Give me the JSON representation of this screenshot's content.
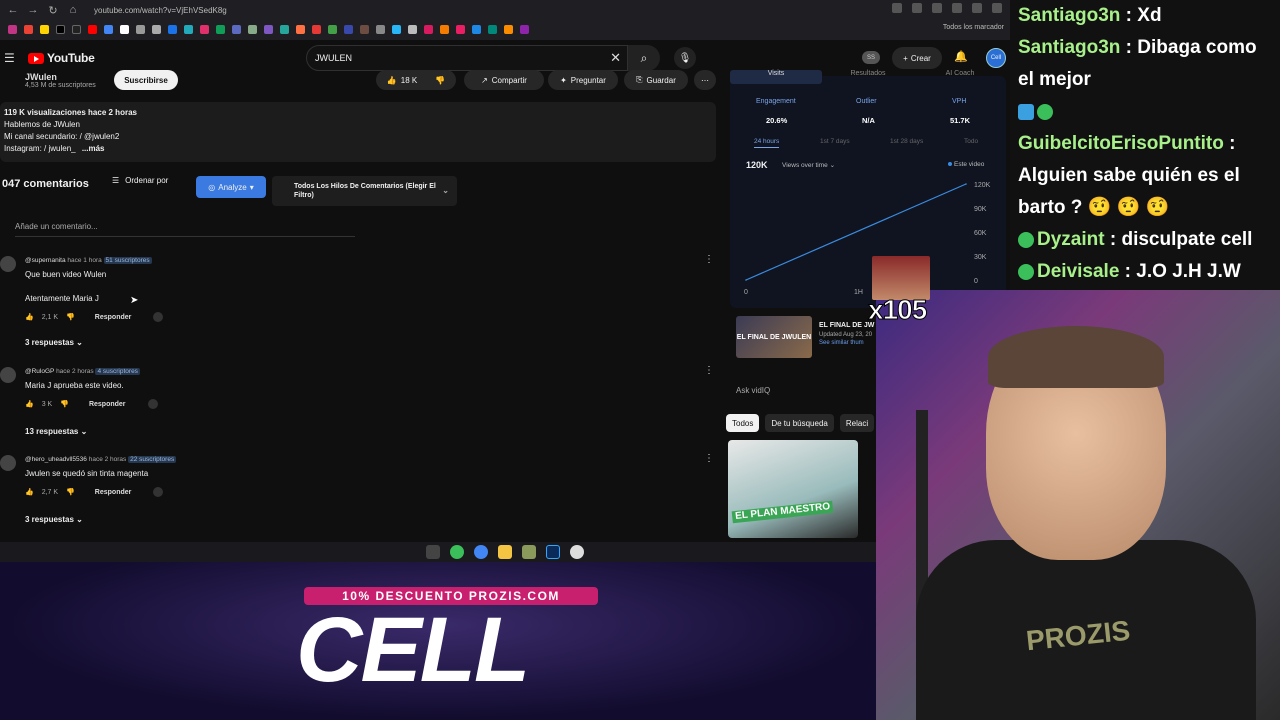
{
  "browser": {
    "url": "youtube.com/watch?v=VjEhVSedK8g",
    "bookmarks_all": "Todos los marcador"
  },
  "ytbar": {
    "logo": "YouTube",
    "search_value": "JWULEN",
    "ss_badge": "SS",
    "create_label": "Crear"
  },
  "video": {
    "channel_name": "JWulen",
    "subscribers": "4,53 M de suscriptores",
    "subscribe_label": "Suscribirse",
    "likes": "18 K",
    "share_label": "Compartir",
    "ask_label": "Preguntar",
    "save_label": "Guardar",
    "desc_line1_bold": "119 K visualizaciones  hace 2 horas",
    "desc_line2": "Hablemos de JWulen",
    "desc_line3": "Mi canal secundario:  / @jwulen2",
    "desc_line4": "Instagram:  / jwulen_",
    "desc_more": "...más"
  },
  "comments_section": {
    "count_label": "047 comentarios",
    "sort_label": "Ordenar por",
    "analyze_label": "Analyze",
    "filter_label": "Todos Los Hilos De Comentarios (Elegir El Filtro)",
    "add_placeholder": "Añade un comentario..."
  },
  "comments": [
    {
      "author": "@supernanita",
      "time": "hace 1 hora",
      "badge": "51 suscriptores",
      "text1": "Que buen video Wulen",
      "text2": "Atentamente Maria J",
      "likes": "2,1 K",
      "reply_label": "Responder",
      "replies": "3 respuestas"
    },
    {
      "author": "@RuloGP",
      "time": "hace 2 horas",
      "badge": "4 suscriptores",
      "text1": "Maria J aprueba este video.",
      "likes": "3 K",
      "reply_label": "Responder",
      "replies": "13 respuestas"
    },
    {
      "author": "@hero_uheadvll5536",
      "time": "hace 2 horas",
      "badge": "22 suscriptores",
      "text1": "Jwulen se quedó sin tinta magenta",
      "likes": "2,7 K",
      "reply_label": "Responder",
      "replies": "3 respuestas"
    }
  ],
  "vidiq": {
    "tabs": [
      "Visits",
      "Resultados",
      "AI Coach"
    ],
    "engagement_label": "Engagement",
    "engagement_value": "20.6%",
    "outlier_label": "Outlier",
    "outlier_value": "N/A",
    "vph_label": "VPH",
    "vph_value": "51.7K",
    "time_24h": "24 hours",
    "time_7d": "1st 7 days",
    "time_28d": "1st 28 days",
    "time_all": "Todo",
    "total_views": "120K",
    "views_dropdown": "Views over time",
    "legend": "Este video",
    "related_title": "EL FINAL DE JW",
    "related_updated": "Updated Aug 23, 20",
    "related_similar": "See similar thum",
    "related_thumb_text": "EL FINAL DE JWULEN",
    "ask_placeholder": "Ask vidIQ",
    "chips": [
      "Todos",
      "De tu búsqueda",
      "Relaci"
    ],
    "rec_thumb_label": "EL PLAN MAESTRO"
  },
  "chart_data": {
    "type": "line",
    "x_tick_labels": [
      "0",
      "1H"
    ],
    "y_tick_labels": [
      "0",
      "30K",
      "60K",
      "90K",
      "120K"
    ],
    "ylim": [
      0,
      120000
    ],
    "series": [
      {
        "name": "Este video",
        "x": [
          0,
          1
        ],
        "values": [
          0,
          120000
        ]
      }
    ]
  },
  "overlay": {
    "multiplier": "x105",
    "promo": "10% DESCUENTO PROZIS.COM",
    "big_text": "CELL"
  },
  "chat": [
    {
      "user": "Santiago3n",
      "text": "Xd"
    },
    {
      "user": "Santiago3n",
      "text": "Dibaga como el mejor"
    },
    {
      "user": "GuibelcitoErisoPuntito",
      "text": "Alguien sabe quién es el barto ?"
    },
    {
      "user": "Dyzaint",
      "text": "disculpate cell"
    },
    {
      "user": "Deivisale",
      "text": "J.O J.H J.W"
    }
  ],
  "colors": {
    "yt_red": "#ff0000",
    "vidiq_blue": "#3b7ae0",
    "chat_user": "#a8f08a",
    "promo_pink": "#c8206e"
  }
}
